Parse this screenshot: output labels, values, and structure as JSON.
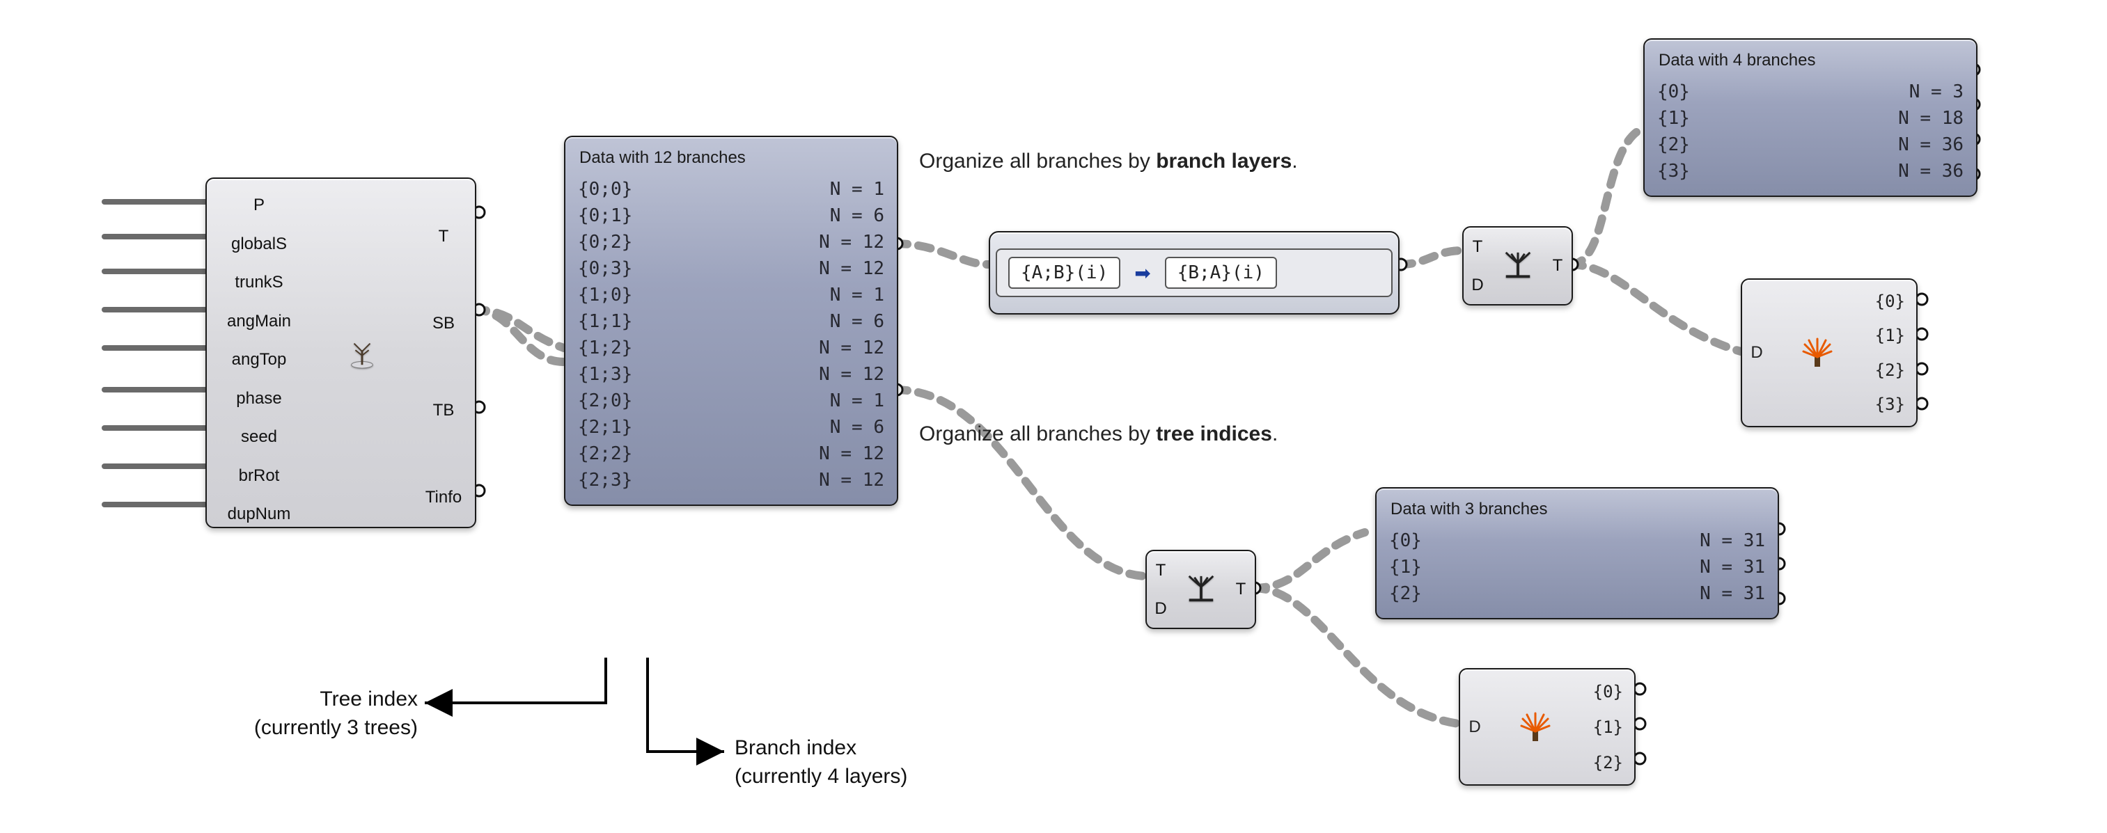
{
  "cluster": {
    "inputs": [
      "P",
      "globalS",
      "trunkS",
      "angMain",
      "angTop",
      "phase",
      "seed",
      "brRot",
      "dupNum"
    ],
    "outputs": [
      "T",
      "SB",
      "TB",
      "Tinfo"
    ]
  },
  "panel12": {
    "title": "Data with 12 branches",
    "rows": [
      {
        "path": "{0;0}",
        "n": "N = 1"
      },
      {
        "path": "{0;1}",
        "n": "N = 6"
      },
      {
        "path": "{0;2}",
        "n": "N = 12"
      },
      {
        "path": "{0;3}",
        "n": "N = 12"
      },
      {
        "path": "{1;0}",
        "n": "N = 1"
      },
      {
        "path": "{1;1}",
        "n": "N = 6"
      },
      {
        "path": "{1;2}",
        "n": "N = 12"
      },
      {
        "path": "{1;3}",
        "n": "N = 12"
      },
      {
        "path": "{2;0}",
        "n": "N = 1"
      },
      {
        "path": "{2;1}",
        "n": "N = 6"
      },
      {
        "path": "{2;2}",
        "n": "N = 12"
      },
      {
        "path": "{2;3}",
        "n": "N = 12"
      }
    ]
  },
  "pathmapper": {
    "src": "{A;B}(i)",
    "dst": "{B;A}(i)"
  },
  "flatten_top": {
    "in_t": "T",
    "in_d": "D",
    "out": "T"
  },
  "flatten_bot": {
    "in_t": "T",
    "in_d": "D",
    "out": "T"
  },
  "panel4": {
    "title": "Data with 4 branches",
    "rows": [
      {
        "path": "{0}",
        "n": "N = 3"
      },
      {
        "path": "{1}",
        "n": "N = 18"
      },
      {
        "path": "{2}",
        "n": "N = 36"
      },
      {
        "path": "{3}",
        "n": "N = 36"
      }
    ]
  },
  "panel3": {
    "title": "Data with 3 branches",
    "rows": [
      {
        "path": "{0}",
        "n": "N = 31"
      },
      {
        "path": "{1}",
        "n": "N = 31"
      },
      {
        "path": "{2}",
        "n": "N = 31"
      }
    ]
  },
  "explode_top": {
    "in": "D",
    "outs": [
      "{0}",
      "{1}",
      "{2}",
      "{3}"
    ]
  },
  "explode_bot": {
    "in": "D",
    "outs": [
      "{0}",
      "{1}",
      "{2}"
    ]
  },
  "note_layers": {
    "pre": "Organize all branches by ",
    "bold": "branch layers",
    "post": "."
  },
  "note_tree": {
    "pre": "Organize all branches by ",
    "bold": "tree indices",
    "post": "."
  },
  "anno_tree": {
    "l1": "Tree index",
    "l2": "(currently 3 trees)"
  },
  "anno_branch": {
    "l1": "Branch index",
    "l2": "(currently 4 layers)"
  }
}
